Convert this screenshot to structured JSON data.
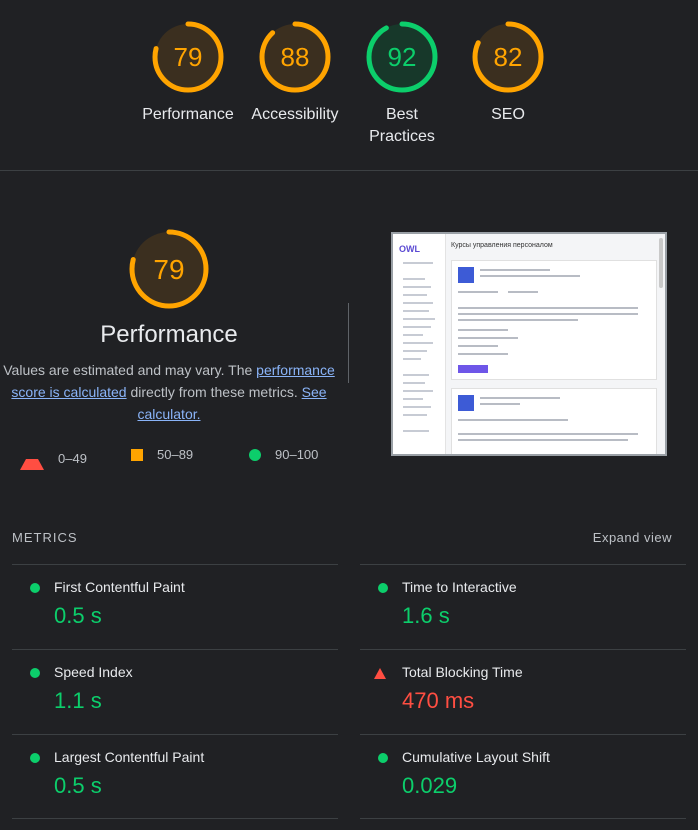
{
  "gauges": [
    {
      "score": "79",
      "label": "Performance",
      "fraction": 0.79,
      "color": "#ffa400",
      "bg": "#3b2f1f"
    },
    {
      "score": "88",
      "label": "Accessibility",
      "fraction": 0.88,
      "color": "#ffa400",
      "bg": "#3b2f1f"
    },
    {
      "score": "92",
      "label_line1": "Best",
      "label_line2": "Practices",
      "fraction": 0.92,
      "color": "#0cce6b",
      "bg": "#17382a"
    },
    {
      "score": "82",
      "label": "SEO",
      "fraction": 0.82,
      "color": "#ffa400",
      "bg": "#3b2f1f"
    }
  ],
  "performance": {
    "score": "79",
    "fraction": 0.79,
    "title": "Performance",
    "desc_start": "Values are estimated and may vary. The ",
    "desc_link1": "performance score is calculated",
    "desc_mid": " directly from these metrics. ",
    "desc_link2": "See calculator.",
    "legend": {
      "poor": "0–49",
      "average": "50–89",
      "good": "90–100"
    }
  },
  "screenshot": {
    "logo": "OWL",
    "heading": "Курсы управления персоналом"
  },
  "metrics": {
    "header": "METRICS",
    "expand": "Expand view",
    "items": [
      {
        "name": "First Contentful Paint",
        "value": "0.5 s",
        "status": "good"
      },
      {
        "name": "Time to Interactive",
        "value": "1.6 s",
        "status": "good"
      },
      {
        "name": "Speed Index",
        "value": "1.1 s",
        "status": "good"
      },
      {
        "name": "Total Blocking Time",
        "value": "470 ms",
        "status": "poor"
      },
      {
        "name": "Largest Contentful Paint",
        "value": "0.5 s",
        "status": "good"
      },
      {
        "name": "Cumulative Layout Shift",
        "value": "0.029",
        "status": "good"
      }
    ]
  },
  "colors": {
    "good": "#0cce6b",
    "average": "#ffa400",
    "poor": "#ff4e42"
  }
}
